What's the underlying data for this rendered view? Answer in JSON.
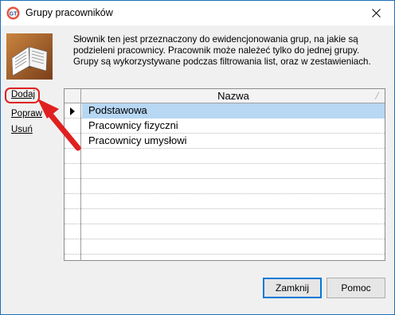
{
  "window": {
    "title": "Grupy pracowników"
  },
  "header": {
    "description": "Słownik ten jest przeznaczony do ewidencjonowania grup, na jakie są podzieleni pracownicy. Pracownik może należeć tylko do jednej grupy. Grupy są wykorzystywane podczas filtrowania list, oraz w zestawieniach."
  },
  "actions": {
    "add": "Dodaj",
    "edit": "Popraw",
    "delete": "Usuń"
  },
  "grid": {
    "column_header": "Nazwa",
    "rows": [
      "Podstawowa",
      "Pracownicy fizyczni",
      "Pracownicy umysłowi"
    ],
    "selected_index": 0
  },
  "buttons": {
    "close": "Zamknij",
    "help": "Pomoc"
  },
  "colors": {
    "selection": "#b7d7f3",
    "annotation": "#e02020",
    "border": "#1c6fb8"
  }
}
